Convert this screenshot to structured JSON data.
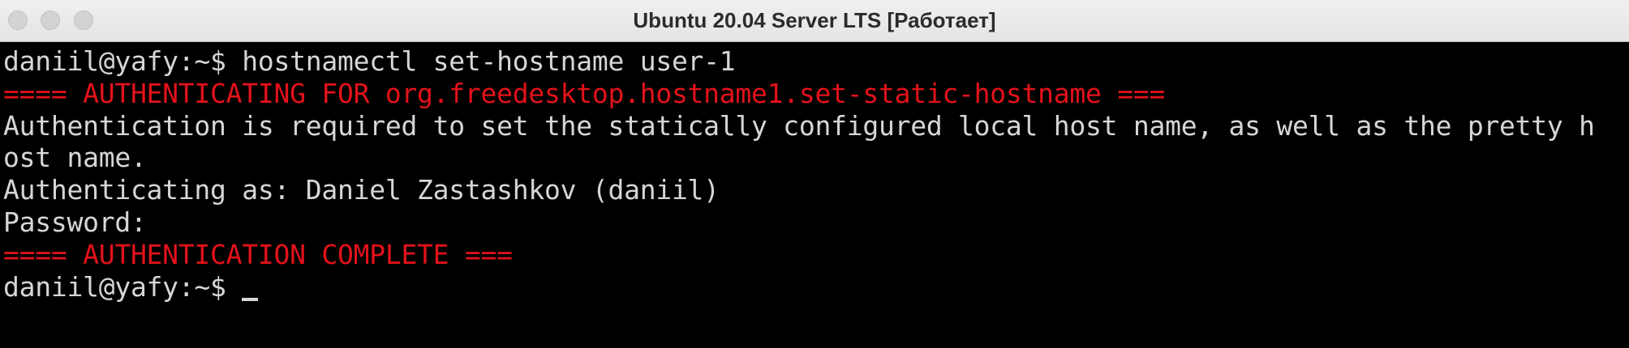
{
  "window": {
    "title": "Ubuntu 20.04 Server LTS [Работает]"
  },
  "terminal": {
    "colors": {
      "background": "#000000",
      "text": "#d6d6d6",
      "highlight": "#e3121a"
    },
    "lines": [
      {
        "text": "daniil@yafy:~$ hostnamectl set-hostname user-1",
        "color": "default"
      },
      {
        "text": "==== AUTHENTICATING FOR org.freedesktop.hostname1.set-static-hostname ===",
        "color": "red"
      },
      {
        "text": "Authentication is required to set the statically configured local host name, as well as the pretty h",
        "color": "default"
      },
      {
        "text": "ost name.",
        "color": "default"
      },
      {
        "text": "Authenticating as: Daniel Zastashkov (daniil)",
        "color": "default"
      },
      {
        "text": "Password:",
        "color": "default"
      },
      {
        "text": "==== AUTHENTICATION COMPLETE ===",
        "color": "red"
      },
      {
        "text": "daniil@yafy:~$ ",
        "color": "default"
      }
    ]
  }
}
